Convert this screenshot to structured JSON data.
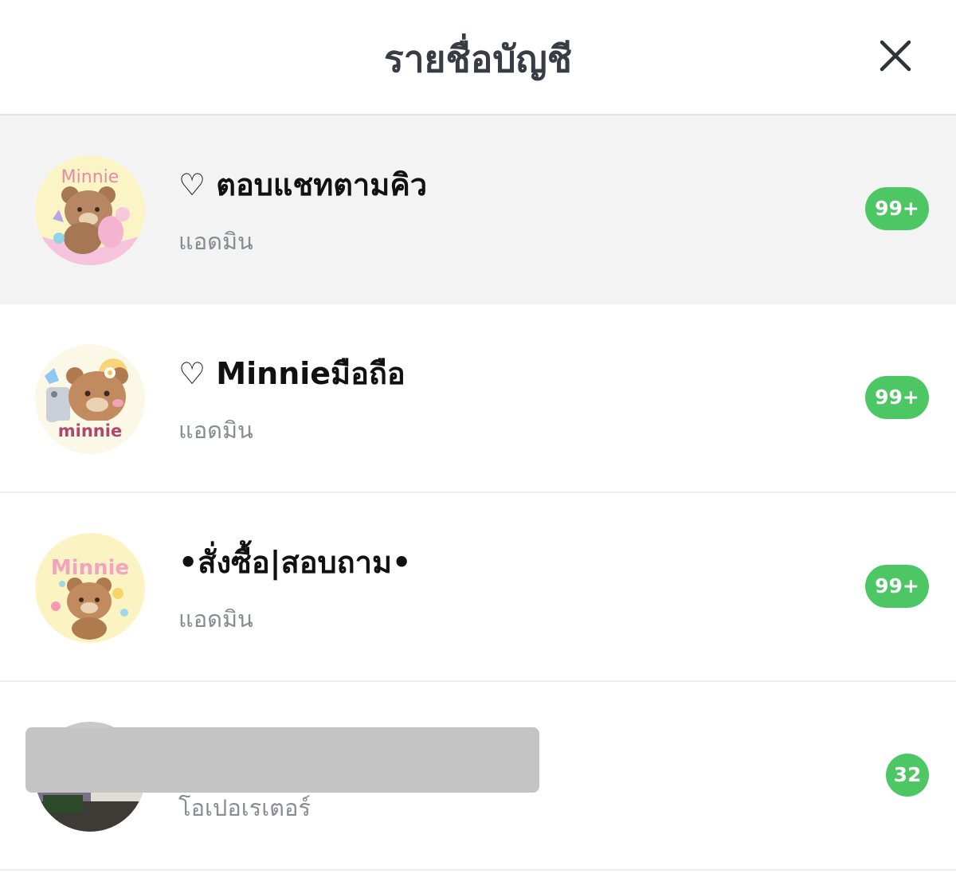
{
  "header": {
    "title": "รายชื่อบัญชี",
    "close_icon": "close-icon"
  },
  "accounts": [
    {
      "name": "♡ ตอบแชทตามคิว",
      "role": "แอดมิน",
      "badge": "99+",
      "avatar_text": "Minnie",
      "selected": true
    },
    {
      "name": "♡ Minnieมือถือ",
      "role": "แอดมิน",
      "badge": "99+",
      "avatar_text": "minnie",
      "selected": false
    },
    {
      "name": "•สั่งซื้อ|สอบถาม•",
      "role": "แอดมิน",
      "badge": "99+",
      "avatar_text": "Minnie",
      "selected": false
    },
    {
      "name": "",
      "role": "โอเปอเรเตอร์",
      "badge": "32",
      "selected": false
    }
  ],
  "colors": {
    "badge": "#4cc764",
    "selected_row": "#f3f3f4",
    "title": "#383c44"
  }
}
